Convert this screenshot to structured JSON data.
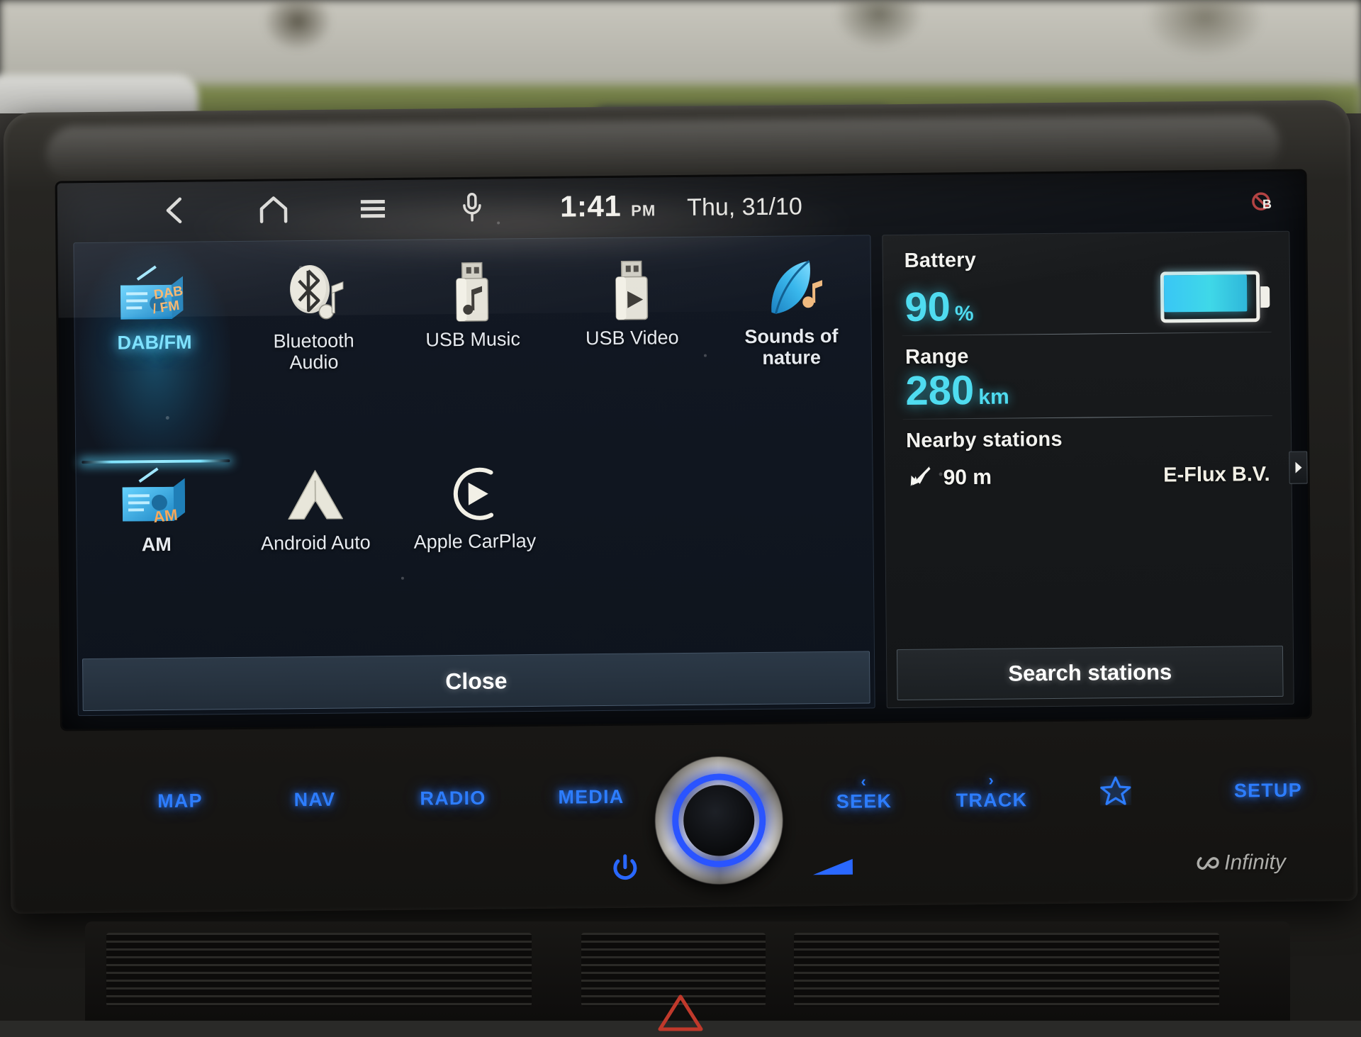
{
  "status_bar": {
    "icons": [
      {
        "name": "back-icon",
        "label": "Back"
      },
      {
        "name": "home-icon",
        "label": "Home"
      },
      {
        "name": "menu-icon",
        "label": "Menu"
      },
      {
        "name": "microphone-icon",
        "label": "Voice"
      }
    ],
    "time": "1:41",
    "ampm": "PM",
    "date": "Thu, 31/10",
    "badge": "mute-notification-badge"
  },
  "media_panel": {
    "sources": [
      {
        "label": "DAB/FM",
        "icon": "radio-dabfm-icon",
        "selected": true,
        "bold": true
      },
      {
        "label": "Bluetooth\nAudio",
        "icon": "bluetooth-audio-icon",
        "selected": false,
        "bold": false
      },
      {
        "label": "USB Music",
        "icon": "usb-music-icon",
        "selected": false,
        "bold": false
      },
      {
        "label": "USB Video",
        "icon": "usb-video-icon",
        "selected": false,
        "bold": false
      },
      {
        "label": "Sounds of\nnature",
        "icon": "sounds-of-nature-icon",
        "selected": false,
        "bold": true
      },
      {
        "label": "AM",
        "icon": "radio-am-icon",
        "selected": false,
        "bold": true
      },
      {
        "label": "Android Auto",
        "icon": "android-auto-icon",
        "selected": false,
        "bold": false
      },
      {
        "label": "Apple CarPlay",
        "icon": "apple-carplay-icon",
        "selected": false,
        "bold": false
      }
    ],
    "close_label": "Close"
  },
  "ev_panel": {
    "battery_label": "Battery",
    "battery_value": "90",
    "battery_unit": "%",
    "battery_percent": 90,
    "range_label": "Range",
    "range_value": "280",
    "range_unit": "km",
    "nearby_label": "Nearby stations",
    "station_distance": "90 m",
    "station_name": "E-Flux B.V.",
    "search_label": "Search stations",
    "scroll_icon": "chevron-right-icon"
  },
  "hardware": {
    "buttons": [
      {
        "label": "MAP",
        "sub": ""
      },
      {
        "label": "NAV",
        "sub": ""
      },
      {
        "label": "RADIO",
        "sub": ""
      },
      {
        "label": "MEDIA",
        "sub": ""
      },
      {
        "label": "SEEK",
        "sub": "‹"
      },
      {
        "label": "TRACK",
        "sub": "›"
      },
      {
        "label": "SETUP",
        "sub": ""
      }
    ],
    "favorite_icon": "star-icon",
    "power_icon": "power-icon",
    "volume_icon": "volume-icon",
    "brand": "Infinity"
  },
  "colors": {
    "accent_cyan": "#4fdcf0",
    "selected_cyan": "#7fe2ff",
    "hw_blue": "#2d7dff",
    "panel_bg": "#121823",
    "screen_bg": "#0c0f14"
  }
}
